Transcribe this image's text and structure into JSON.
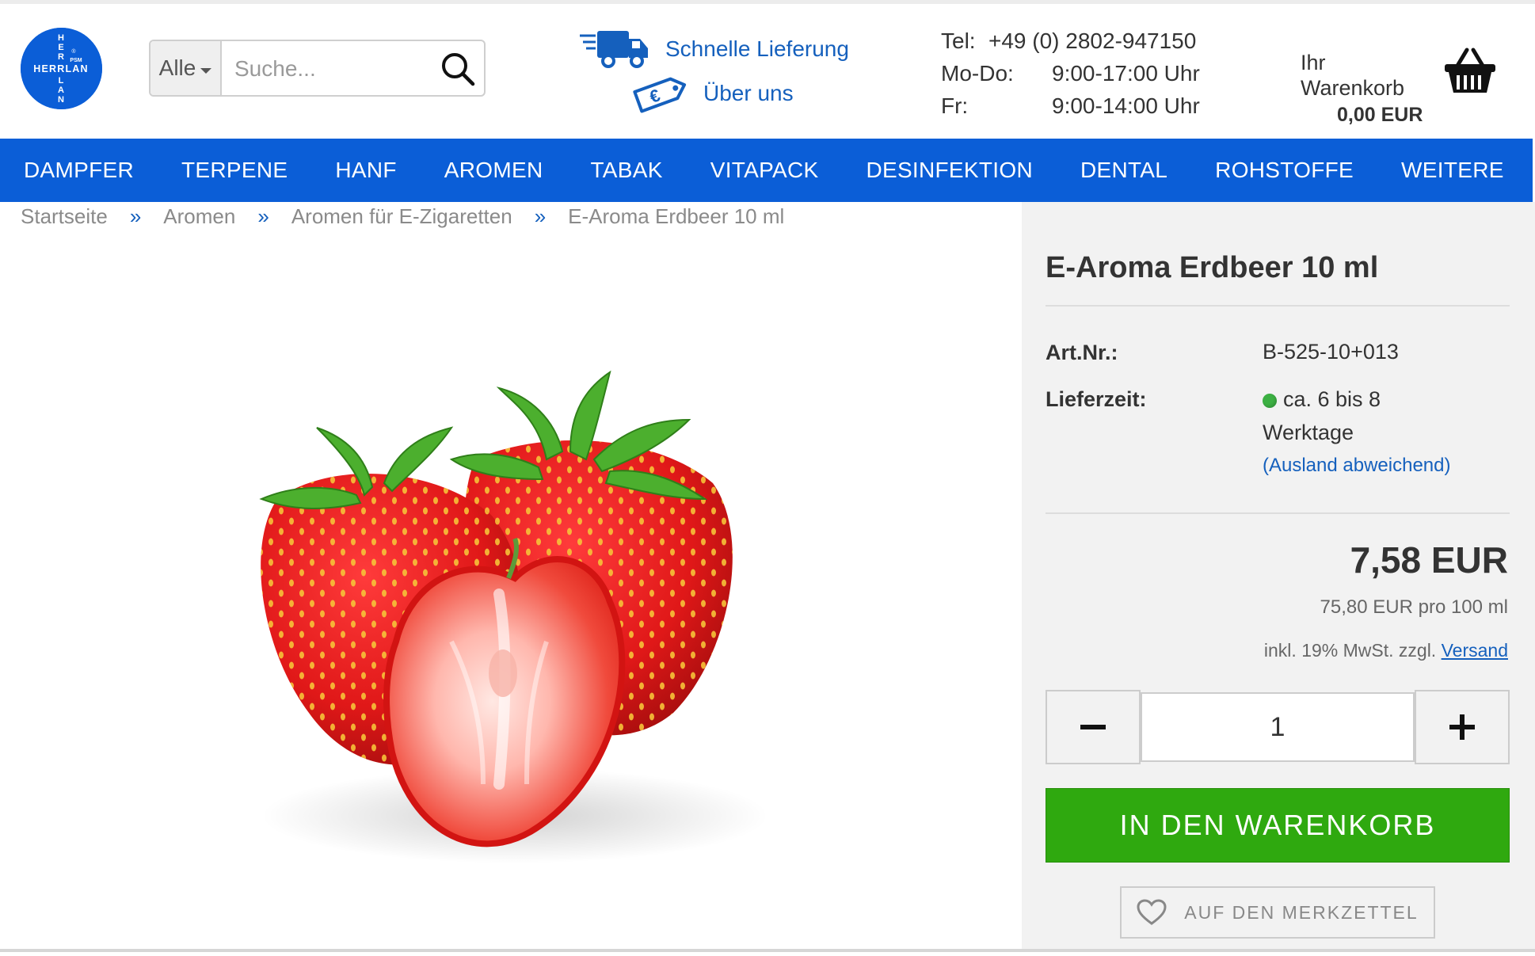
{
  "brand": {
    "logo_vertical": "HERRLAN",
    "logo_horizontal": "HERRLAN",
    "logo_mark": "PSM",
    "registered": "®",
    "primary_color": "#0b5ed7",
    "link_color": "#1560bd",
    "cta_color": "#2fa90f"
  },
  "search": {
    "scope": "Alle",
    "placeholder": "Suche...",
    "icon": "search-icon"
  },
  "services": {
    "delivery": {
      "label": "Schnelle Lieferung",
      "icon": "truck-icon"
    },
    "about": {
      "label": "Über uns",
      "icon": "euro-tag-icon"
    }
  },
  "contact": {
    "tel_label": "Tel:",
    "tel_value": "+49 (0) 2802-947150",
    "hours": [
      {
        "label": "Mo-Do:",
        "value": "9:00-17:00 Uhr"
      },
      {
        "label": "Fr:",
        "value": "9:00-14:00 Uhr"
      }
    ]
  },
  "cart": {
    "label_line1": "Ihr",
    "label_line2": "Warenkorb",
    "total": "0,00 EUR",
    "icon": "basket-icon"
  },
  "nav": {
    "items": [
      "DAMPFER",
      "TERPENE",
      "HANF",
      "AROMEN",
      "TABAK",
      "VITAPACK",
      "DESINFEKTION",
      "DENTAL",
      "ROHSTOFFE",
      "WEITERE"
    ]
  },
  "breadcrumb": {
    "items": [
      "Startseite",
      "Aromen",
      "Aromen für E-Zigaretten",
      "E-Aroma Erdbeer 10 ml"
    ],
    "separator": "»"
  },
  "product": {
    "title": "E-Aroma Erdbeer 10 ml",
    "image": "strawberries-image",
    "artnr_label": "Art.Nr.:",
    "artnr_value": "B-525-10+013",
    "delivery_label": "Lieferzeit:",
    "delivery_value_line1": "ca. 6 bis 8",
    "delivery_value_line2": "Werktage",
    "delivery_abroad": "(Ausland abweichend)",
    "delivery_status_color": "#3cb043",
    "price": "7,58 EUR",
    "base_price": "75,80 EUR pro 100 ml",
    "tax_text": "inkl. 19% MwSt. zzgl.",
    "shipping_link": "Versand",
    "quantity": "1",
    "decrement": "−",
    "increment": "+",
    "add_to_cart": "IN DEN WARENKORB",
    "wishlist": "AUF DEN MERKZETTEL"
  }
}
